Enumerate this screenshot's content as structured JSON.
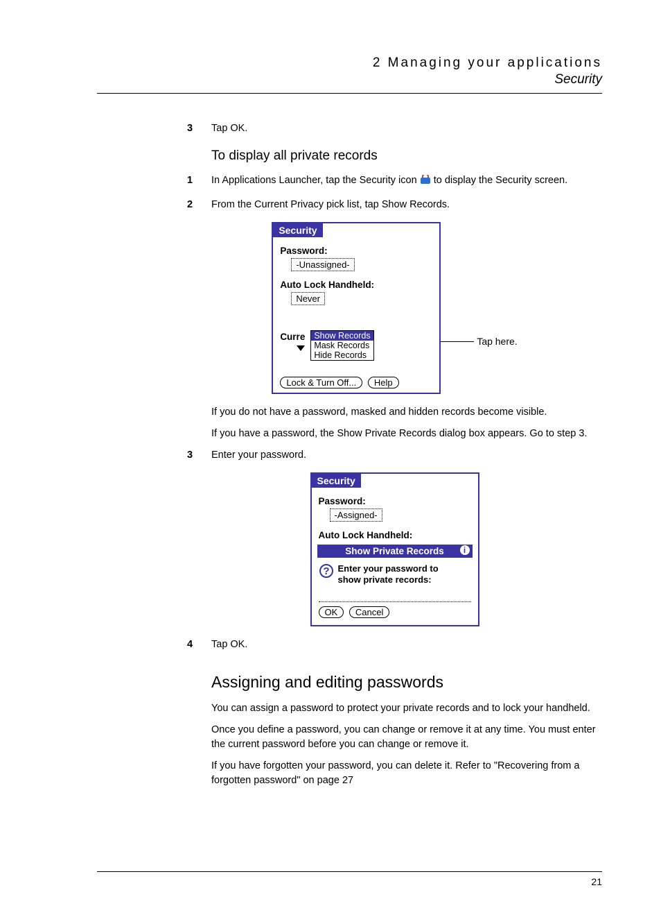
{
  "header": {
    "chapter": "2 Managing your applications",
    "section": "Security"
  },
  "steps_a": {
    "s3": {
      "num": "3",
      "text": "Tap OK."
    }
  },
  "subheading1": "To display all private records",
  "steps_b": {
    "s1": {
      "num": "1",
      "text_before": "In Applications Launcher, tap the Security icon ",
      "text_after": " to display the Security screen."
    },
    "s2": {
      "num": "2",
      "text": "From the Current Privacy pick list, tap Show Records."
    }
  },
  "screen1": {
    "title": "Security",
    "password_label": "Password:",
    "password_value": "-Unassigned-",
    "autolock_label": "Auto Lock Handheld:",
    "autolock_value": "Never",
    "curre": "Curre",
    "popup": {
      "opt1": "Show Records",
      "opt2": "Mask Records",
      "opt3": "Hide Records"
    },
    "btn_lock": "Lock & Turn Off...",
    "btn_help": "Help",
    "callout": "Tap here."
  },
  "para_nopass": "If you do not have a password, masked and hidden records become visible.",
  "para_haspass": "If you have a password, the Show Private Records dialog box appears. Go to step 3.",
  "steps_c": {
    "s3": {
      "num": "3",
      "text": "Enter your password."
    }
  },
  "screen2": {
    "title": "Security",
    "password_label": "Password:",
    "password_value": "-Assigned-",
    "autolock_label": "Auto Lock Handheld:",
    "dialog_title": "Show Private Records",
    "prompt_l1": "Enter your password to",
    "prompt_l2": "show private records:",
    "btn_ok": "OK",
    "btn_cancel": "Cancel"
  },
  "steps_d": {
    "s4": {
      "num": "4",
      "text": "Tap OK."
    }
  },
  "sectheading": "Assigning and editing passwords",
  "para_assign1": "You can assign a password to protect your private records and to lock your handheld.",
  "para_assign2": "Once you define a password, you can change or remove it at any time. You must enter the current password before you can change or remove it.",
  "para_assign3": "If you have forgotten your password, you can delete it. Refer to \"Recovering from a forgotten password\" on page 27",
  "footer": {
    "page": "21"
  }
}
